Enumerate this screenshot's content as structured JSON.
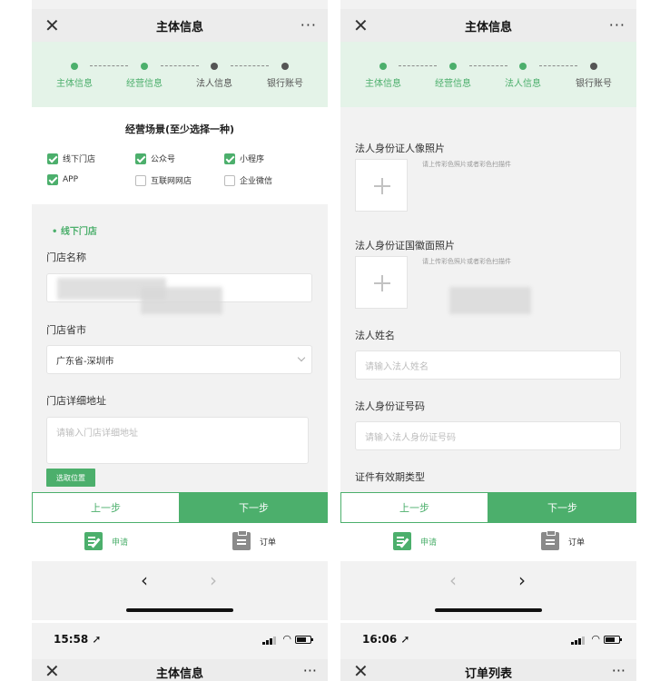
{
  "colors": {
    "green": "#4caf6c",
    "light_green": "#e4f3e8",
    "grey_step": "#555555",
    "placeholder": "#bdbdbd"
  },
  "icons": {
    "close": "close-icon",
    "more": "more-icon",
    "apply": "apply-edit-icon",
    "order": "order-clipboard-icon",
    "back": "chevron-left-icon",
    "forward": "chevron-right-icon"
  },
  "screen1": {
    "nav": {
      "close": "✕",
      "title": "主体信息",
      "more": "···"
    },
    "steps": [
      {
        "label": "主体信息"
      },
      {
        "label": "经营信息"
      },
      {
        "label": "法人信息"
      },
      {
        "label": "银行账号"
      }
    ],
    "scene_title": "经营场景(至少选择一种)",
    "scenes": [
      {
        "label": "线下门店",
        "checked": true
      },
      {
        "label": "公众号",
        "checked": true
      },
      {
        "label": "小程序",
        "checked": true
      },
      {
        "label": "APP",
        "checked": true
      },
      {
        "label": "互联网网店",
        "checked": false
      },
      {
        "label": "企业微信",
        "checked": false
      }
    ],
    "section": "• 线下门店",
    "store_name_label": "门店名称",
    "store_city_label": "门店省市",
    "store_city_value": "广东省-深圳市",
    "store_addr_label": "门店详细地址",
    "store_addr_placeholder": "请输入门店详细地址",
    "select_location": "选取位置",
    "prev": "上一步",
    "next": "下一步",
    "tab_apply": "申请",
    "tab_order": "订单",
    "back": "‹",
    "forward": "›"
  },
  "screen2": {
    "nav": {
      "close": "✕",
      "title": "主体信息",
      "more": "···"
    },
    "steps": [
      {
        "label": "主体信息"
      },
      {
        "label": "经营信息"
      },
      {
        "label": "法人信息"
      },
      {
        "label": "银行账号"
      }
    ],
    "id_front_label": "法人身份证人像照片",
    "id_front_hint": "请上传彩色照片或者彩色扫描件",
    "id_back_label": "法人身份证国徽面照片",
    "id_back_hint": "请上传彩色照片或者彩色扫描件",
    "name_label": "法人姓名",
    "name_placeholder": "请输入法人姓名",
    "idno_label": "法人身份证号码",
    "idno_placeholder": "请输入法人身份证号码",
    "validity_label": "证件有效期类型",
    "prev": "上一步",
    "next": "下一步",
    "tab_apply": "申请",
    "tab_order": "订单",
    "back": "‹",
    "forward": "›"
  },
  "screen3": {
    "time": "15:58 ➚",
    "nav": {
      "close": "✕",
      "title": "主体信息",
      "more": "···"
    }
  },
  "screen4": {
    "time": "16:06 ➚",
    "nav": {
      "close": "✕",
      "title": "订单列表",
      "more": "···"
    }
  }
}
